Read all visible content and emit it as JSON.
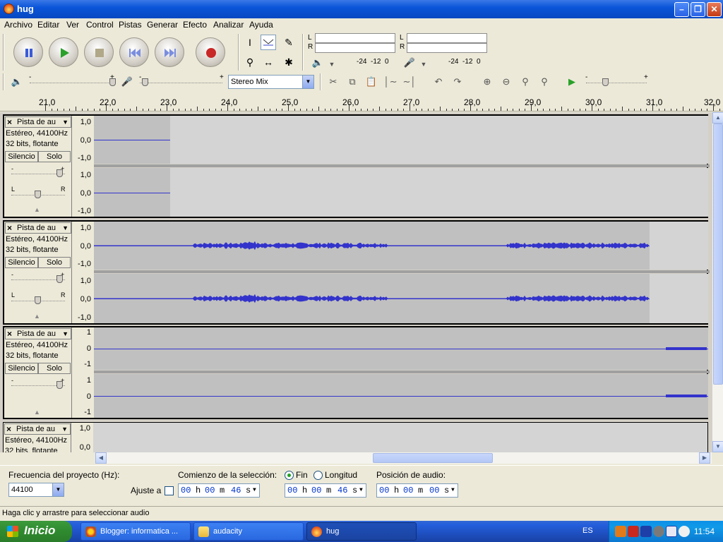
{
  "window": {
    "title": "hug"
  },
  "menu": [
    "Archivo",
    "Editar",
    "Ver",
    "Control",
    "Pistas",
    "Generar",
    "Efecto",
    "Analizar",
    "Ayuda"
  ],
  "transport": {
    "pause": "pause-icon",
    "play": "play-icon",
    "stop": "stop-icon",
    "skip_start": "skip-start-icon",
    "skip_end": "skip-end-icon",
    "record": "record-icon"
  },
  "meters": {
    "play_L": "L",
    "play_R": "R",
    "rec_L": "L",
    "rec_R": "R",
    "play_scale": "-24  -12  0",
    "rec_scale": "-24  -12  0"
  },
  "mixer": {
    "input_source": "Stereo Mix"
  },
  "ruler": {
    "labels": [
      "21,0",
      "22,0",
      "23,0",
      "24,0",
      "25,0",
      "26,0",
      "27,0",
      "28,0",
      "29,0",
      "30,0",
      "31,0",
      "32,0"
    ]
  },
  "tracks": [
    {
      "name": "Pista de au",
      "format": "Estéreo, 44100Hz",
      "bits": "32 bits, flotante",
      "mute": "Silencio",
      "solo": "Solo",
      "scale_top": "1,0",
      "scale_mid": "0,0",
      "scale_bot": "-1,0"
    },
    {
      "name": "Pista de au",
      "format": "Estéreo, 44100Hz",
      "bits": "32 bits, flotante",
      "mute": "Silencio",
      "solo": "Solo",
      "scale_top": "1,0",
      "scale_mid": "0,0",
      "scale_bot": "-1,0"
    },
    {
      "name": "Pista de au",
      "format": "Estéreo, 44100Hz",
      "bits": "32 bits, flotante",
      "mute": "Silencio",
      "solo": "Solo",
      "scale_top": "1",
      "scale_mid": "0",
      "scale_bot": "-1"
    },
    {
      "name": "Pista de au",
      "format": "Estéreo, 44100Hz",
      "bits": "32 bits, flotante",
      "scale_top": "1,0",
      "scale_mid": "0,0"
    }
  ],
  "gain_labels": {
    "minus": "-",
    "plus": "+",
    "L": "L",
    "R": "R"
  },
  "selection": {
    "rate_label": "Frecuencia del proyecto (Hz):",
    "rate_value": "44100",
    "snap_label": "Ajuste a",
    "start_label": "Comienzo de la selección:",
    "end_label": "Fin",
    "length_label": "Longitud",
    "pos_label": "Posición de audio:",
    "start_time": {
      "h": "00",
      "m": "00",
      "s": "46",
      "uh": "h",
      "um": "m",
      "us": "s"
    },
    "end_time": {
      "h": "00",
      "m": "00",
      "s": "46",
      "uh": "h",
      "um": "m",
      "us": "s"
    },
    "pos_time": {
      "h": "00",
      "m": "00",
      "s": "00",
      "uh": "h",
      "um": "m",
      "us": "s"
    }
  },
  "status": "Haga clic y arrastre para seleccionar audio",
  "taskbar": {
    "start": "Inicio",
    "tasks": [
      "Blogger: informatica ...",
      "audacity",
      "hug"
    ],
    "lang": "ES",
    "clock": "11:54"
  }
}
